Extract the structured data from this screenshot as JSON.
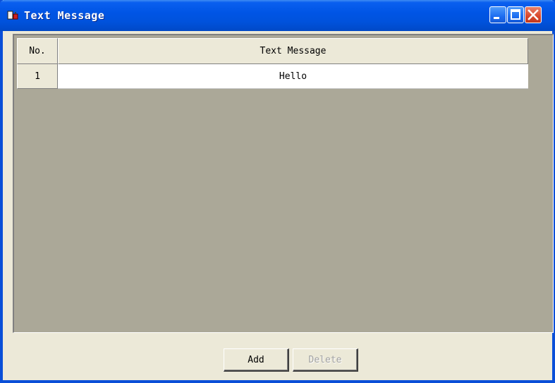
{
  "window": {
    "title": "Text Message",
    "icon": "app-icon"
  },
  "titlebar_buttons": {
    "minimize": "minimize-icon",
    "maximize": "maximize-icon",
    "close": "close-icon"
  },
  "table": {
    "columns": [
      "No.",
      "Text Message"
    ],
    "rows": [
      {
        "no": "1",
        "message": "Hello"
      }
    ]
  },
  "buttons": {
    "add_label": "Add",
    "delete_label": "Delete",
    "delete_enabled": false
  },
  "colors": {
    "titlebar": "#0055E5",
    "client_bg": "#ABA898",
    "window_bg": "#ECE9D8",
    "close_button": "#D9472B"
  }
}
